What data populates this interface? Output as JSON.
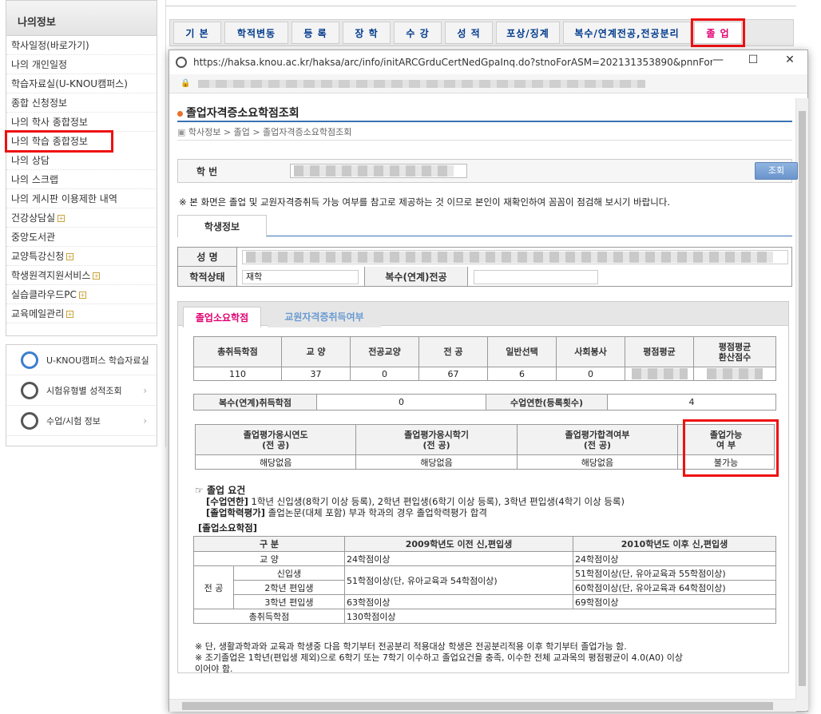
{
  "sidebar": {
    "title": "나의정보",
    "items": [
      {
        "label": "학사일정(바로가기)",
        "plus": false
      },
      {
        "label": "나의 개인일정",
        "plus": false
      },
      {
        "label": "학습자료실(U-KNOU캠퍼스)",
        "plus": false
      },
      {
        "label": "종합 신청정보",
        "plus": false
      },
      {
        "label": "나의 학사 종합정보",
        "plus": false
      },
      {
        "label": "나의 학습 종합정보",
        "plus": false,
        "highlight": true
      },
      {
        "label": "나의 상담",
        "plus": false
      },
      {
        "label": "나의 스크랩",
        "plus": false
      },
      {
        "label": "나의 게시판 이용제한 내역",
        "plus": false
      },
      {
        "label": "건강상담실",
        "plus": true
      },
      {
        "label": "중앙도서관",
        "plus": false
      },
      {
        "label": "교양특강신청",
        "plus": true
      },
      {
        "label": "학생원격지원서비스",
        "plus": true
      },
      {
        "label": "실습클라우드PC",
        "plus": true
      },
      {
        "label": "교육메일관리",
        "plus": true
      }
    ],
    "quick": [
      {
        "label": "U-KNOU캠퍼스 학습자료실",
        "icon": "u-knou-logo-icon"
      },
      {
        "label": "시험유형별 성적조회",
        "icon": "exam-icon"
      },
      {
        "label": "수업/시험 정보",
        "icon": "headset-icon"
      }
    ]
  },
  "tabs": [
    "기  본",
    "학적변동",
    "등  록",
    "장  학",
    "수  강",
    "성  적",
    "포상/징계",
    "복수/연계전공,전공분리",
    "졸  업"
  ],
  "active_tab": 8,
  "popup": {
    "url": "https://haksa.knou.ac.kr/haksa/arc/info/initARCGrduCertNedGpaInq.do?stnoForASM=202131353890&pnnForASM=...",
    "title": "졸업자격증소요학점조회",
    "breadcrumb": "학사정보 > 졸업 > 졸업자격증소요학점조회",
    "student_no_label": "학  번",
    "search_button": "조회",
    "notice": "※ 본 화면은 졸업 및 교원자격증취득 가능 여부를 참고로 제공하는 것 이므로 본인이 재확인하여 꼼꼼이 점검해 보시기 바랍니다.",
    "student_tab": "학생정보",
    "name_label": "성  명",
    "status_label": "학적상태",
    "status_value": "재학",
    "double_major_label": "복수(연계)전공",
    "subtabs": [
      "졸업소요학점",
      "교원자격증취득여부"
    ],
    "credit_headers": [
      "총취득학점",
      "교  양",
      "전공교양",
      "전  공",
      "일반선택",
      "사회봉사",
      "평점평균",
      "평점평균\n환산점수"
    ],
    "credit_values": [
      "110",
      "37",
      "0",
      "67",
      "6",
      "0"
    ],
    "double_credit_label": "복수(연계)취득학점",
    "double_credit_value": "0",
    "term_label": "수업연한(등록횟수)",
    "term_value": "4",
    "eval_headers": [
      "졸업평가응시연도\n(전    공)",
      "졸업평가응시학기\n(전    공)",
      "졸업평가합격여부\n(전    공)",
      "졸업가능\n여    부"
    ],
    "eval_values": [
      "해당없음",
      "해당없음",
      "해당없음",
      "불가능"
    ],
    "req_title": "졸업 요건",
    "req_lines": [
      {
        "tag": "[수업연한]",
        "text": "1학년 신입생(8학기 이상 등록), 2학년 편입생(6학기 이상 등록), 3학년 편입생(4학기 이상 등록)"
      },
      {
        "tag": "[졸업학력평가]",
        "text": "졸업논문(대체 포함) 부과 학과의 경우 졸업학력평가 합격"
      }
    ],
    "req_sub": "[졸업소요학점]",
    "req_headers": [
      "구    분",
      "2009학년도 이전 신,편입생",
      "2010학년도 이후 신,편입생"
    ],
    "req_rows": {
      "liberal": {
        "label": "교  양",
        "old": "24학점이상",
        "new": "24학점이상"
      },
      "major_label": "전  공",
      "freshman": {
        "label": "신입생",
        "new": "51학점이상(단, 유아교육과 55학점이상)"
      },
      "second": {
        "label": "2학년 편입생",
        "new": "60학점이상(단, 유아교육과 64학점이상)"
      },
      "major_old_12": "51학점이상(단, 유아교육과 54학점이상)",
      "third": {
        "label": "3학년 편입생",
        "old": "63학점이상",
        "new": "69학점이상"
      },
      "total": {
        "label": "총취득학점",
        "old": "130학점이상"
      }
    },
    "footnotes": [
      "※ 단, 생활과학과와 교육과 학생중 다음 학기부터 전공분리 적용대상 학생은 전공분리적용 이후 학기부터 졸업가능 함.",
      "※ 조기졸업은 1학년(편입생 제외)으로 6학기 또는 7학기 이수하고 졸업요건을 충족, 이수한 전체 교과목의 평점평균이 4.0(A0) 이상",
      "   이어야 함."
    ]
  }
}
